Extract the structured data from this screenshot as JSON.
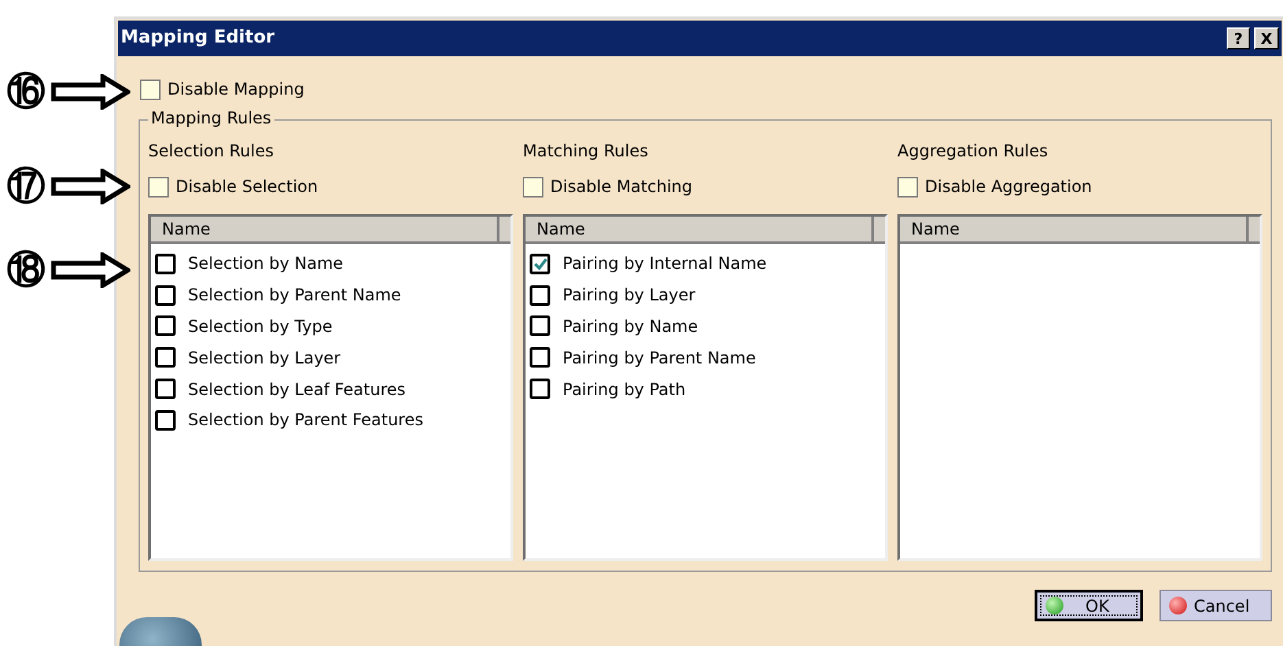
{
  "window": {
    "title": "Mapping Editor",
    "buttons": [
      {
        "kind": "help",
        "label": "?"
      },
      {
        "kind": "close",
        "label": "X"
      }
    ]
  },
  "callouts": [
    {
      "label": "⑯"
    },
    {
      "label": "⑰"
    },
    {
      "label": "⑱"
    }
  ],
  "disable_mapping": {
    "label": "Disable Mapping",
    "checked": false
  },
  "mapping_rules": {
    "title": "Mapping Rules",
    "columns": [
      {
        "title": "Selection Rules",
        "disable": {
          "label": "Disable Selection",
          "checked": false
        },
        "header": "Name",
        "items": [
          {
            "label": "Selection by Name",
            "checked": false
          },
          {
            "label": "Selection by Parent Name",
            "checked": false
          },
          {
            "label": "Selection by Type",
            "checked": false
          },
          {
            "label": "Selection by Layer",
            "checked": false
          },
          {
            "label": "Selection by Leaf Features",
            "checked": false
          },
          {
            "label": "Selection by Parent Features",
            "checked": false
          }
        ]
      },
      {
        "title": "Matching Rules",
        "disable": {
          "label": "Disable Matching",
          "checked": false
        },
        "header": "Name",
        "items": [
          {
            "label": "Pairing by Internal Name",
            "checked": true
          },
          {
            "label": "Pairing by Layer",
            "checked": false
          },
          {
            "label": "Pairing by Name",
            "checked": false
          },
          {
            "label": "Pairing by Parent Name",
            "checked": false
          },
          {
            "label": "Pairing by Path",
            "checked": false
          }
        ]
      },
      {
        "title": "Aggregation Rules",
        "disable": {
          "label": "Disable Aggregation",
          "checked": false
        },
        "header": "Name"
      }
    ]
  },
  "buttons": [
    {
      "kind": "ok",
      "label": "OK",
      "focused": true
    },
    {
      "kind": "cancel",
      "label": "Cancel",
      "focused": false
    }
  ]
}
